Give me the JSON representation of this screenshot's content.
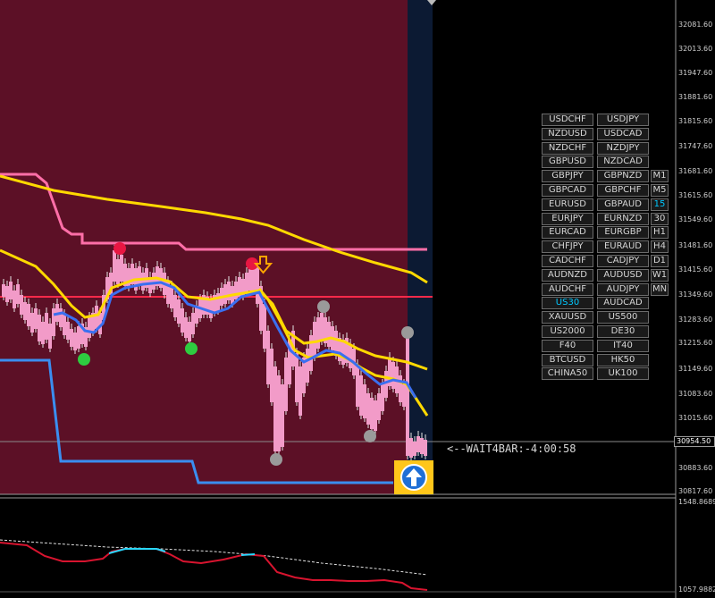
{
  "price_axis": {
    "labels": [
      "32081.60",
      "32013.60",
      "31947.60",
      "31881.60",
      "31815.60",
      "31747.60",
      "31681.60",
      "31615.60",
      "31549.60",
      "31481.60",
      "31415.60",
      "31349.60",
      "31283.60",
      "31215.60",
      "31149.60",
      "31083.60",
      "31015.60",
      "30883.60",
      "30817.60"
    ],
    "current_price": "30954.50"
  },
  "indicator_axis": {
    "top": "1548.8689",
    "bottom": "1057.9882"
  },
  "status_text": "<--WAIT4BAR:-4:00:58",
  "symbol_buttons": [
    [
      "USDCHF",
      "USDJPY"
    ],
    [
      "NZDUSD",
      "USDCAD"
    ],
    [
      "NZDCHF",
      "NZDJPY"
    ],
    [
      "GBPUSD",
      "NZDCAD"
    ],
    [
      "GBPJPY",
      "GBPNZD"
    ],
    [
      "GBPCAD",
      "GBPCHF"
    ],
    [
      "EURUSD",
      "GBPAUD"
    ],
    [
      "EURJPY",
      "EURNZD"
    ],
    [
      "EURCAD",
      "EURGBP"
    ],
    [
      "CHFJPY",
      "EURAUD"
    ],
    [
      "CADCHF",
      "CADJPY"
    ],
    [
      "AUDNZD",
      "AUDUSD"
    ],
    [
      "AUDCHF",
      "AUDJPY"
    ],
    [
      "US30",
      "AUDCAD"
    ],
    [
      "XAUUSD",
      "US500"
    ],
    [
      "US2000",
      "DE30"
    ],
    [
      "F40",
      "IT40"
    ],
    [
      "BTCUSD",
      "HK50"
    ],
    [
      "CHINA50",
      "UK100"
    ]
  ],
  "active_symbol": "US30",
  "timeframes": [
    "M1",
    "M5",
    "15",
    "30",
    "H1",
    "H4",
    "D1",
    "W1",
    "MN"
  ],
  "active_timeframe": "15",
  "colors": {
    "background": "#000000",
    "chart_area": "#5c1026",
    "current_zone": "#0c1a33",
    "candle": "#f29bc8",
    "pink_line": "#ff6fa8",
    "yellow_line": "#ffd900",
    "blue_line": "#3a6ff0",
    "red_level": "#ff2a4a",
    "accent_active": "#00c8ff",
    "signal_box": "#ffc61a",
    "osc_red": "#d8142f",
    "osc_cyan": "#2ad8ff"
  },
  "icons": {
    "down_arrow": "down-arrow-icon",
    "up_signal": "up-arrow-icon"
  }
}
